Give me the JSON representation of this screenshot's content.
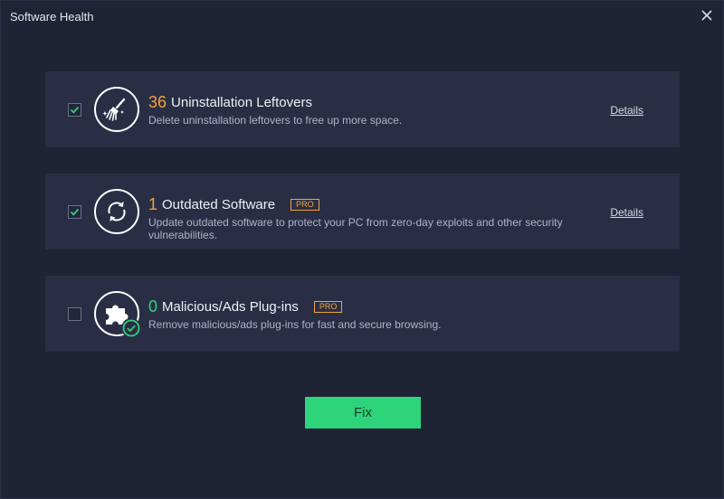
{
  "window": {
    "title": "Software Health"
  },
  "colors": {
    "accent_orange": "#f0a53a",
    "fix_green": "#2ed47a",
    "check_green": "#2ed47a"
  },
  "items": [
    {
      "checked": true,
      "icon": "broom-icon",
      "count": "36",
      "title": "Uninstallation Leftovers",
      "pro": null,
      "description": "Delete uninstallation leftovers to free up more space.",
      "details_label": "Details"
    },
    {
      "checked": true,
      "icon": "refresh-icon",
      "count": "1",
      "title": "Outdated Software",
      "pro": "PRO",
      "description": "Update outdated software to protect your PC from zero-day exploits and other security vulnerabilities.",
      "details_label": "Details"
    },
    {
      "checked": false,
      "icon": "puzzle-icon",
      "count": "0",
      "title": "Malicious/Ads Plug-ins",
      "pro": "PRO",
      "description": "Remove malicious/ads plug-ins for fast and secure browsing.",
      "details_label": null
    }
  ],
  "fix_button": {
    "label": "Fix"
  }
}
